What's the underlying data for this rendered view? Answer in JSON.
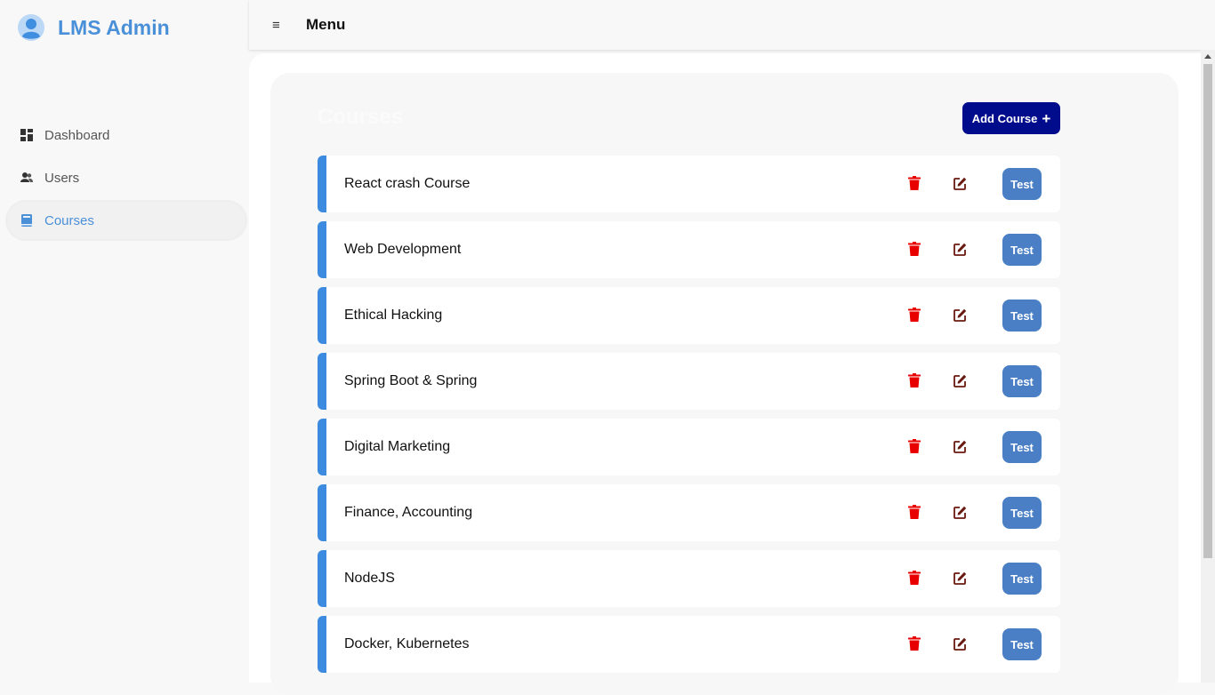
{
  "sidebar": {
    "brand": "LMS Admin",
    "items": [
      {
        "label": "Dashboard",
        "icon": "dashboard-icon",
        "active": false
      },
      {
        "label": "Users",
        "icon": "users-icon",
        "active": false
      },
      {
        "label": "Courses",
        "icon": "book-icon",
        "active": true
      }
    ]
  },
  "topbar": {
    "menu_label": "Menu",
    "menu_icon": "≡"
  },
  "main": {
    "title": "Courses",
    "add_button": {
      "label": "Add Course",
      "icon": "+"
    },
    "courses": [
      {
        "name": "React crash Course",
        "test_label": "Test"
      },
      {
        "name": "Web Development",
        "test_label": "Test"
      },
      {
        "name": "Ethical Hacking",
        "test_label": "Test"
      },
      {
        "name": "Spring Boot & Spring",
        "test_label": "Test"
      },
      {
        "name": "Digital Marketing",
        "test_label": "Test"
      },
      {
        "name": "Finance, Accounting",
        "test_label": "Test"
      },
      {
        "name": "NodeJS",
        "test_label": "Test"
      },
      {
        "name": "Docker, Kubernetes",
        "test_label": "Test"
      }
    ]
  },
  "colors": {
    "accent": "#4a90d9",
    "add_button": "#000c8c",
    "test_button": "#4a7fc5",
    "row_border": "#3c8be0",
    "trash": "#e80000",
    "edit": "#6a1a10"
  }
}
